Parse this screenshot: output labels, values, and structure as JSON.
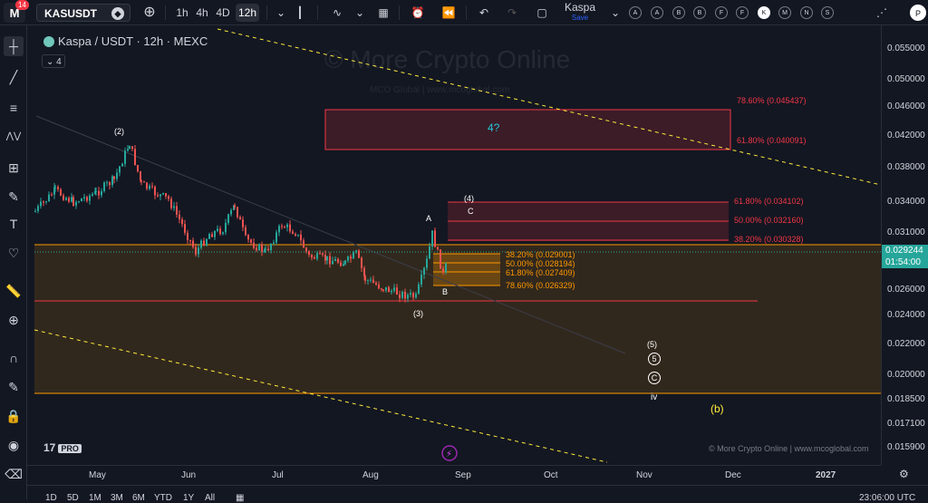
{
  "topbar": {
    "notification_count": "14",
    "symbol": "KASUSDT",
    "intervals": [
      "1h",
      "4h",
      "4D",
      "12h"
    ],
    "active_interval": "12h",
    "layout_name": "Kaspa",
    "layout_status": "Save",
    "drawing_letters": [
      "A",
      "A",
      "B",
      "B",
      "F",
      "F",
      "K",
      "M",
      "N",
      "S"
    ],
    "selected_letter": "K",
    "profile": "P"
  },
  "legend": {
    "title": "Kaspa / USDT · 12h · MEXC",
    "indicator_count": "4"
  },
  "watermark": {
    "main": "© More Crypto Online",
    "sub": "MCO Global | www.mcoglobal.com"
  },
  "y_axis": {
    "ticks": [
      "0.055000",
      "0.050000",
      "0.046000",
      "0.042000",
      "0.038000",
      "0.034000",
      "0.031000",
      "0.026000",
      "0.024000",
      "0.022000",
      "0.020000",
      "0.018500",
      "0.017100",
      "0.015900"
    ],
    "current_price": "0.029244",
    "countdown": "01:54:00"
  },
  "x_axis": {
    "ticks": [
      "May",
      "Jun",
      "Jul",
      "Aug",
      "Sep",
      "Oct",
      "Nov",
      "Dec",
      "2027"
    ]
  },
  "fib_upper": [
    "78.60% (0.045437)",
    "61.80% (0.040091)"
  ],
  "fib_mid": [
    "61.80% (0.034102)",
    "50.00% (0.032160)",
    "38.20% (0.030328)"
  ],
  "fib_low": [
    "38.20% (0.029001)",
    "50.00% (0.028194)",
    "61.80% (0.027409)",
    "78.60% (0.026329)"
  ],
  "wave_labels": {
    "w2": "(2)",
    "w3": "(3)",
    "w4": "(4)",
    "wA": "A",
    "wB": "B",
    "wC": "C",
    "w4q": "4?",
    "w5": "(5)",
    "w5c": "5",
    "wCc": "C",
    "wiv": "iv",
    "wb": "(b)"
  },
  "footer": {
    "tv_logo": "17",
    "tv_badge": "PRO",
    "copyright": "© More Crypto Online  |  www.mcoglobal.com"
  },
  "bottombar": {
    "ranges": [
      "1D",
      "5D",
      "1M",
      "3M",
      "6M",
      "YTD",
      "1Y",
      "All"
    ],
    "time": "23:06:00 UTC"
  },
  "colors": {
    "background": "#131722",
    "candle_up": "#26a69a",
    "candle_down": "#ef5350",
    "fib_red": "#f23645",
    "fib_orange": "#ff9800",
    "wave_yellow": "#ffeb3b"
  }
}
